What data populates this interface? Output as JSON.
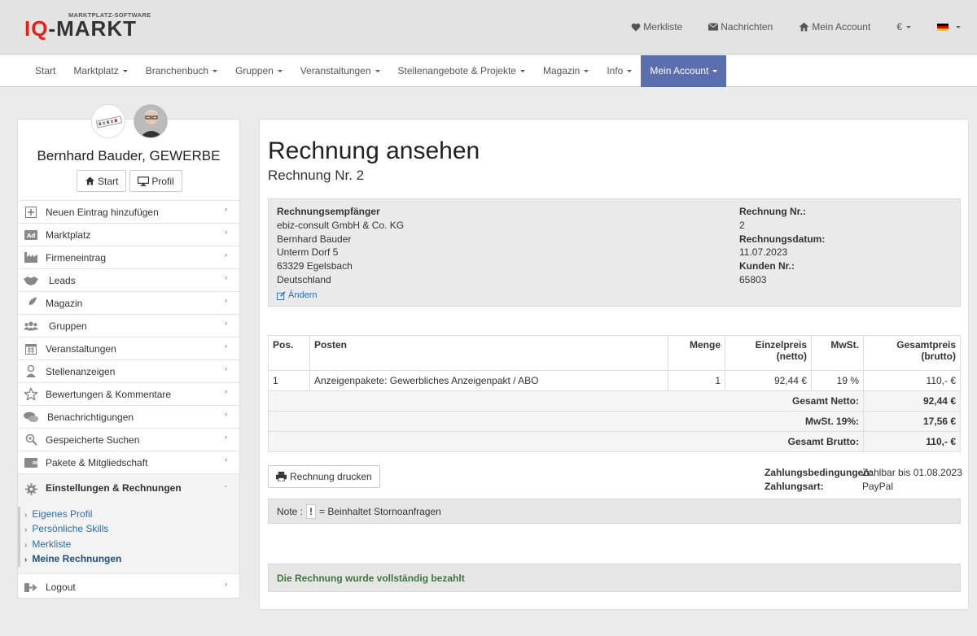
{
  "header": {
    "logo_subtitle": "MARKTPLATZ-SOFTWARE",
    "logo_prefix": "IQ",
    "logo_suffix": "-MARKT",
    "links": {
      "watchlist": "Merkliste",
      "messages": "Nachrichten",
      "account": "Mein Account",
      "currency": "€"
    }
  },
  "nav": {
    "items": [
      "Start",
      "Marktplatz",
      "Branchenbuch",
      "Gruppen",
      "Veranstaltungen",
      "Stellenangebote & Projekte",
      "Magazin",
      "Info",
      "Mein Account"
    ],
    "active": "Mein Account"
  },
  "sidebar": {
    "user_name": "Bernhard Bauder, GEWERBE",
    "start_btn": "Start",
    "profile_btn": "Profil",
    "items": [
      {
        "label": "Neuen Eintrag hinzufügen",
        "icon": "plus-square-icon"
      },
      {
        "label": "Marktplatz",
        "icon": "ad-icon"
      },
      {
        "label": "Firmeneintrag",
        "icon": "industry-icon"
      },
      {
        "label": "Leads",
        "icon": "handshake-icon"
      },
      {
        "label": "Magazin",
        "icon": "feather-icon"
      },
      {
        "label": "Gruppen",
        "icon": "users-icon"
      },
      {
        "label": "Veranstaltungen",
        "icon": "calendar-icon"
      },
      {
        "label": "Stellenanzeigen",
        "icon": "user-tie-icon"
      },
      {
        "label": "Bewertungen & Kommentare",
        "icon": "star-icon"
      },
      {
        "label": "Benachrichtigungen",
        "icon": "comments-icon"
      },
      {
        "label": "Gespeicherte Suchen",
        "icon": "search-plus-icon"
      },
      {
        "label": "Pakete & Mitgliedschaft",
        "icon": "wallet-icon"
      }
    ],
    "settings": {
      "label": "Einstellungen & Rechnungen",
      "sub": [
        "Eigenes Profil",
        "Persönliche Skills",
        "Merkliste",
        "Meine Rechnungen"
      ],
      "current": "Meine Rechnungen"
    },
    "logout": "Logout"
  },
  "invoice": {
    "title": "Rechnung ansehen",
    "subtitle": "Rechnung Nr. 2",
    "recipient_label": "Rechnungsempfänger",
    "recipient_lines": [
      "ebiz-consult GmbH & Co. KG",
      "Bernhard Bauder",
      "Unterm Dorf 5",
      "63329 Egelsbach",
      "Deutschland"
    ],
    "edit_link": "Ändern",
    "number_label": "Rechnung Nr.:",
    "number": "2",
    "date_label": "Rechnungsdatum:",
    "date": "11.07.2023",
    "customer_label": "Kunden Nr.:",
    "customer": "65803",
    "table": {
      "headers": {
        "pos": "Pos.",
        "item": "Posten",
        "qty": "Menge",
        "unit1": "Einzelpreis",
        "unit2": "(netto)",
        "vat": "MwSt.",
        "total1": "Gesamtpreis",
        "total2": "(brutto)"
      },
      "rows": [
        {
          "pos": "1",
          "item": "Anzeigenpakete: Gewerbliches Anzeigenpakt / ABO",
          "qty": "1",
          "unit": "92,44 €",
          "vat": "19 %",
          "total": "110,- €"
        }
      ],
      "sums": [
        {
          "label": "Gesamt Netto:",
          "value": "92,44 €"
        },
        {
          "label": "MwSt. 19%:",
          "value": "17,56 €"
        },
        {
          "label": "Gesamt Brutto:",
          "value": "110,- €"
        }
      ]
    },
    "print_btn": "Rechnung drucken",
    "terms_label": "Zahlungsbedingungen:",
    "terms_value": "Zahlbar bis 01.08.2023",
    "payment_label": "Zahlungsart:",
    "payment_value": "PayPal",
    "note_prefix": "Note :",
    "note_bang": "!",
    "note_text": "= Beinhaltet Stornoanfragen",
    "paid_message": "Die Rechnung wurde vollständig bezahlt"
  },
  "colors": {
    "accent": "#5b6fae",
    "link": "#2a6fb0",
    "success": "#3c763d",
    "logo_red": "#e2231a"
  }
}
